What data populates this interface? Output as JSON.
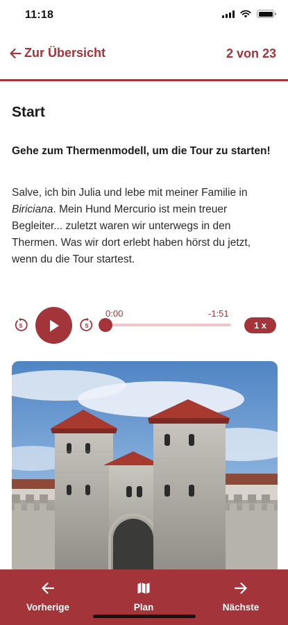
{
  "status_bar": {
    "time": "11:18",
    "icons": [
      "signal-icon",
      "wifi-icon",
      "battery-icon"
    ]
  },
  "nav": {
    "back_label": "Zur Übersicht",
    "back_icon": "arrow-left-icon",
    "page_indicator": "2 von 23"
  },
  "station": {
    "title": "Start",
    "instruction": "Gehe zum Thermenmodell, um die Tour zu starten!",
    "description_before": "Salve, ich bin Julia und lebe mit meiner Familie in ",
    "description_emphasis": "Biriciana",
    "description_after": ". Mein Hund Mercurio ist mein treuer Begleiter... zuletzt waren wir unterwegs in den Thermen. Was wir dort erlebt haben hörst du jetzt, wenn du die Tour startest."
  },
  "audio": {
    "elapsed": "0:00",
    "remaining": "-1:51",
    "progress": 0,
    "speed": "1 x",
    "skip_back_label": "5",
    "skip_forward_label": "5"
  },
  "image": {
    "subject": "roman-gate-towers"
  },
  "bottom_nav": {
    "prev_label": "Vorherige",
    "plan_label": "Plan",
    "next_label": "Nächste"
  },
  "colors": {
    "accent": "#a3343a",
    "accent_light": "#f0c7c9",
    "text": "#1f1f1f",
    "background": "#ffffff"
  }
}
